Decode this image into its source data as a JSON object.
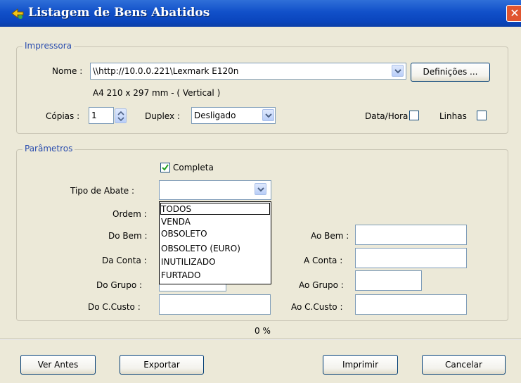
{
  "window": {
    "title": "Listagem de Bens Abatidos"
  },
  "printer": {
    "legend": "Impressora",
    "name_label": "Nome :",
    "name_value": "\\\\http://10.0.0.221\\Lexmark E120n",
    "settings_button": "Definições ...",
    "paper_info": "A4 210 x 297 mm  -  ( Vertical )",
    "copies_label": "Cópias :",
    "copies_value": "1",
    "duplex_label": "Duplex :",
    "duplex_value": "Desligado",
    "datetime_label": "Data/Hora",
    "lines_label": "Linhas"
  },
  "params": {
    "legend": "Parâmetros",
    "complete_label": "Completa",
    "tipo_label": "Tipo de Abate :",
    "ordem_label": "Ordem :",
    "do_bem_label": "Do Bem :",
    "ao_bem_label": "Ao Bem :",
    "da_conta_label": "Da Conta :",
    "a_conta_label": "A Conta :",
    "do_grupo_label": "Do Grupo :",
    "ao_grupo_label": "Ao Grupo :",
    "do_ccusto_label": "Do C.Custo :",
    "ao_ccusto_label": "Ao C.Custo :",
    "options": [
      "TODOS",
      "VENDA",
      "OBSOLETO",
      "OBSOLETO (EURO)",
      "INUTILIZADO",
      "FURTADO"
    ]
  },
  "progress": {
    "label": "0 %",
    "value": 0
  },
  "footer": {
    "preview_button": "Ver Antes",
    "export_button": "Exportar",
    "print_button": "Imprimir",
    "cancel_button": "Cancelar"
  }
}
